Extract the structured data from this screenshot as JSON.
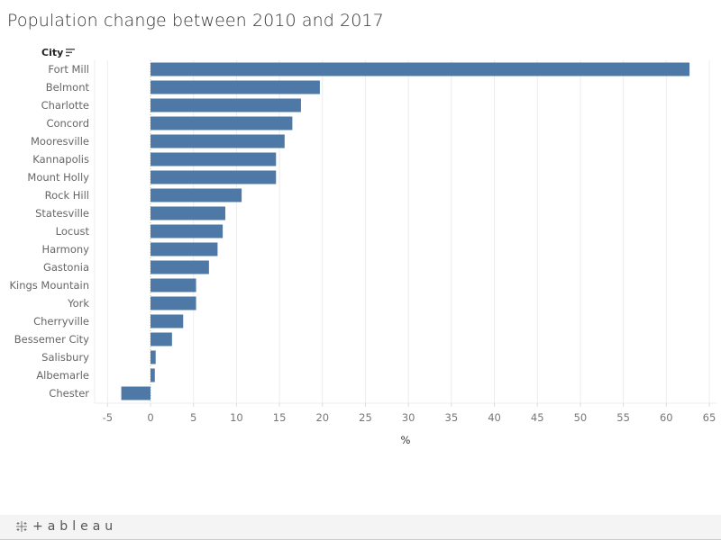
{
  "chart_data": {
    "type": "bar",
    "orientation": "horizontal",
    "title": "Population change between 2010 and 2017",
    "category_header": "City",
    "xlabel": "%",
    "ylabel": "City",
    "xlim": [
      -6.5,
      65.5
    ],
    "grid": true,
    "categories": [
      "Fort Mill",
      "Belmont",
      "Charlotte",
      "Concord",
      "Mooresville",
      "Kannapolis",
      "Mount Holly",
      "Rock Hill",
      "Statesville",
      "Locust",
      "Harmony",
      "Gastonia",
      "Kings Mountain",
      "York",
      "Cherryville",
      "Bessemer City",
      "Salisbury",
      "Albemarle",
      "Chester"
    ],
    "values": [
      62.7,
      19.7,
      17.5,
      16.5,
      15.6,
      14.6,
      14.6,
      10.6,
      8.7,
      8.4,
      7.8,
      6.8,
      5.3,
      5.3,
      3.8,
      2.5,
      0.6,
      0.5,
      -3.4
    ],
    "ticks": [
      -5,
      0,
      5,
      10,
      15,
      20,
      25,
      30,
      35,
      40,
      45,
      50,
      55,
      60,
      65
    ],
    "bar_color": "#4e79a7"
  },
  "footer": {
    "brand": "+ableau"
  }
}
